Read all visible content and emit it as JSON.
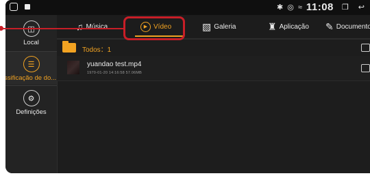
{
  "status": {
    "time": "11:08"
  },
  "sidebar": {
    "items": [
      {
        "label": "Local",
        "icon": "floppy-disc-icon"
      },
      {
        "label": "assificação de do...",
        "icon": "list-icon"
      },
      {
        "label": "Definições",
        "icon": "gear-icon"
      }
    ]
  },
  "tabs": [
    {
      "label": "Música",
      "icon": "music-note-icon"
    },
    {
      "label": "Vídeo",
      "icon": "play-circle-icon"
    },
    {
      "label": "Galeria",
      "icon": "picture-icon"
    },
    {
      "label": "Aplicação",
      "icon": "android-icon"
    },
    {
      "label": "Documento",
      "icon": "document-icon"
    }
  ],
  "list": {
    "all_label": "Todos：1",
    "files": [
      {
        "name": "yuandao test.mp4",
        "meta": "1970-01-20 14:16:58  57.06MB"
      }
    ]
  },
  "colors": {
    "accent": "#f2a322",
    "highlight": "#c81e27",
    "background": "#1d1d1d"
  }
}
